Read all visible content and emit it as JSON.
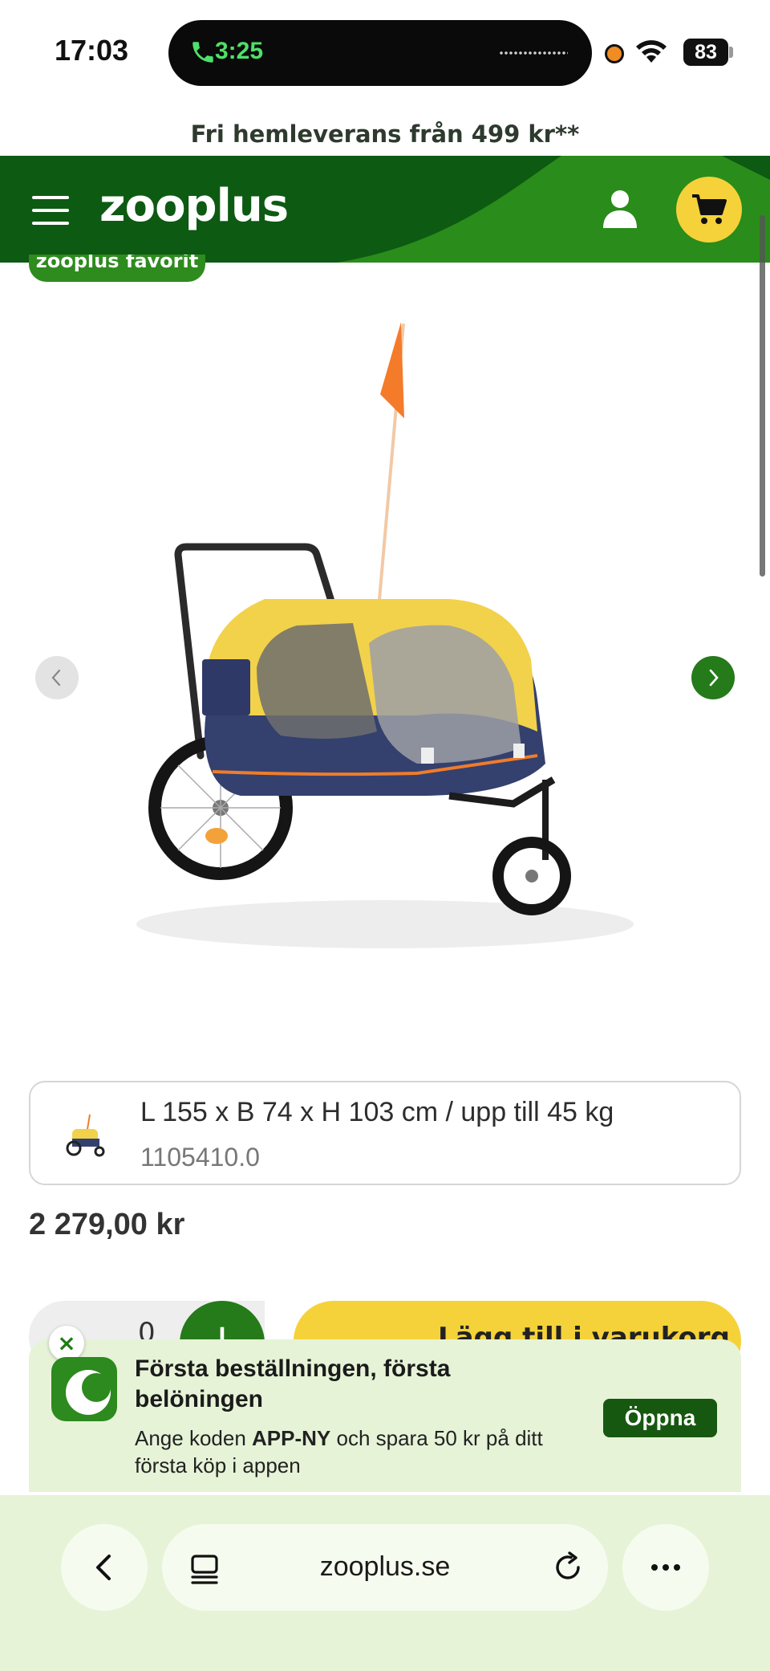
{
  "status_bar": {
    "time": "17:03",
    "call_duration": "3:25",
    "battery": "83"
  },
  "promo_strip": {
    "text": "Fri hemleverans från 499 kr**"
  },
  "header": {
    "logo": "zooplus",
    "colors": {
      "header_green": "#0d5a12",
      "accent_green": "#2e8b1e",
      "cart_yellow": "#f5d23a"
    }
  },
  "product": {
    "badge": "zooplus favorit",
    "variant_size": "L 155 x B 74 x H 103 cm / upp till 45 kg",
    "variant_sku": "1105410.0",
    "price": "2 279,00 kr",
    "quantity": "0",
    "add_to_cart_label": "Lägg till i varukorg"
  },
  "app_banner": {
    "title": "Första beställningen, första belöningen",
    "desc_prefix": "Ange koden ",
    "code": "APP-NY",
    "desc_suffix": " och spara 50 kr på ditt första köp i appen",
    "open_label": "Öppna",
    "close_label": "×"
  },
  "browser": {
    "host": "zooplus.se"
  }
}
